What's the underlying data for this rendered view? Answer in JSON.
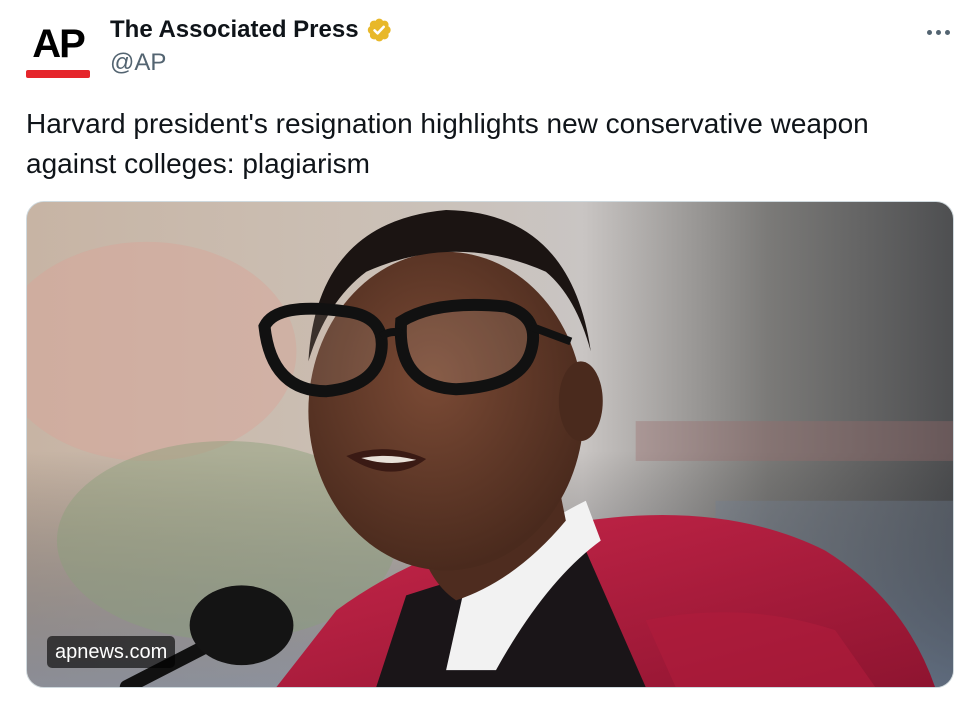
{
  "author": {
    "display_name": "The Associated Press",
    "handle": "@AP",
    "avatar_text": "AP",
    "verified_color": "#e8b829",
    "brand_red": "#e5262b"
  },
  "tweet": {
    "text": "Harvard president's resignation highlights new conservative weapon against colleges: plagiarism"
  },
  "card": {
    "domain": "apnews.com",
    "image_subject": "photo"
  },
  "icons": {
    "verified": "verified-badge-icon",
    "more": "more-options-icon"
  }
}
